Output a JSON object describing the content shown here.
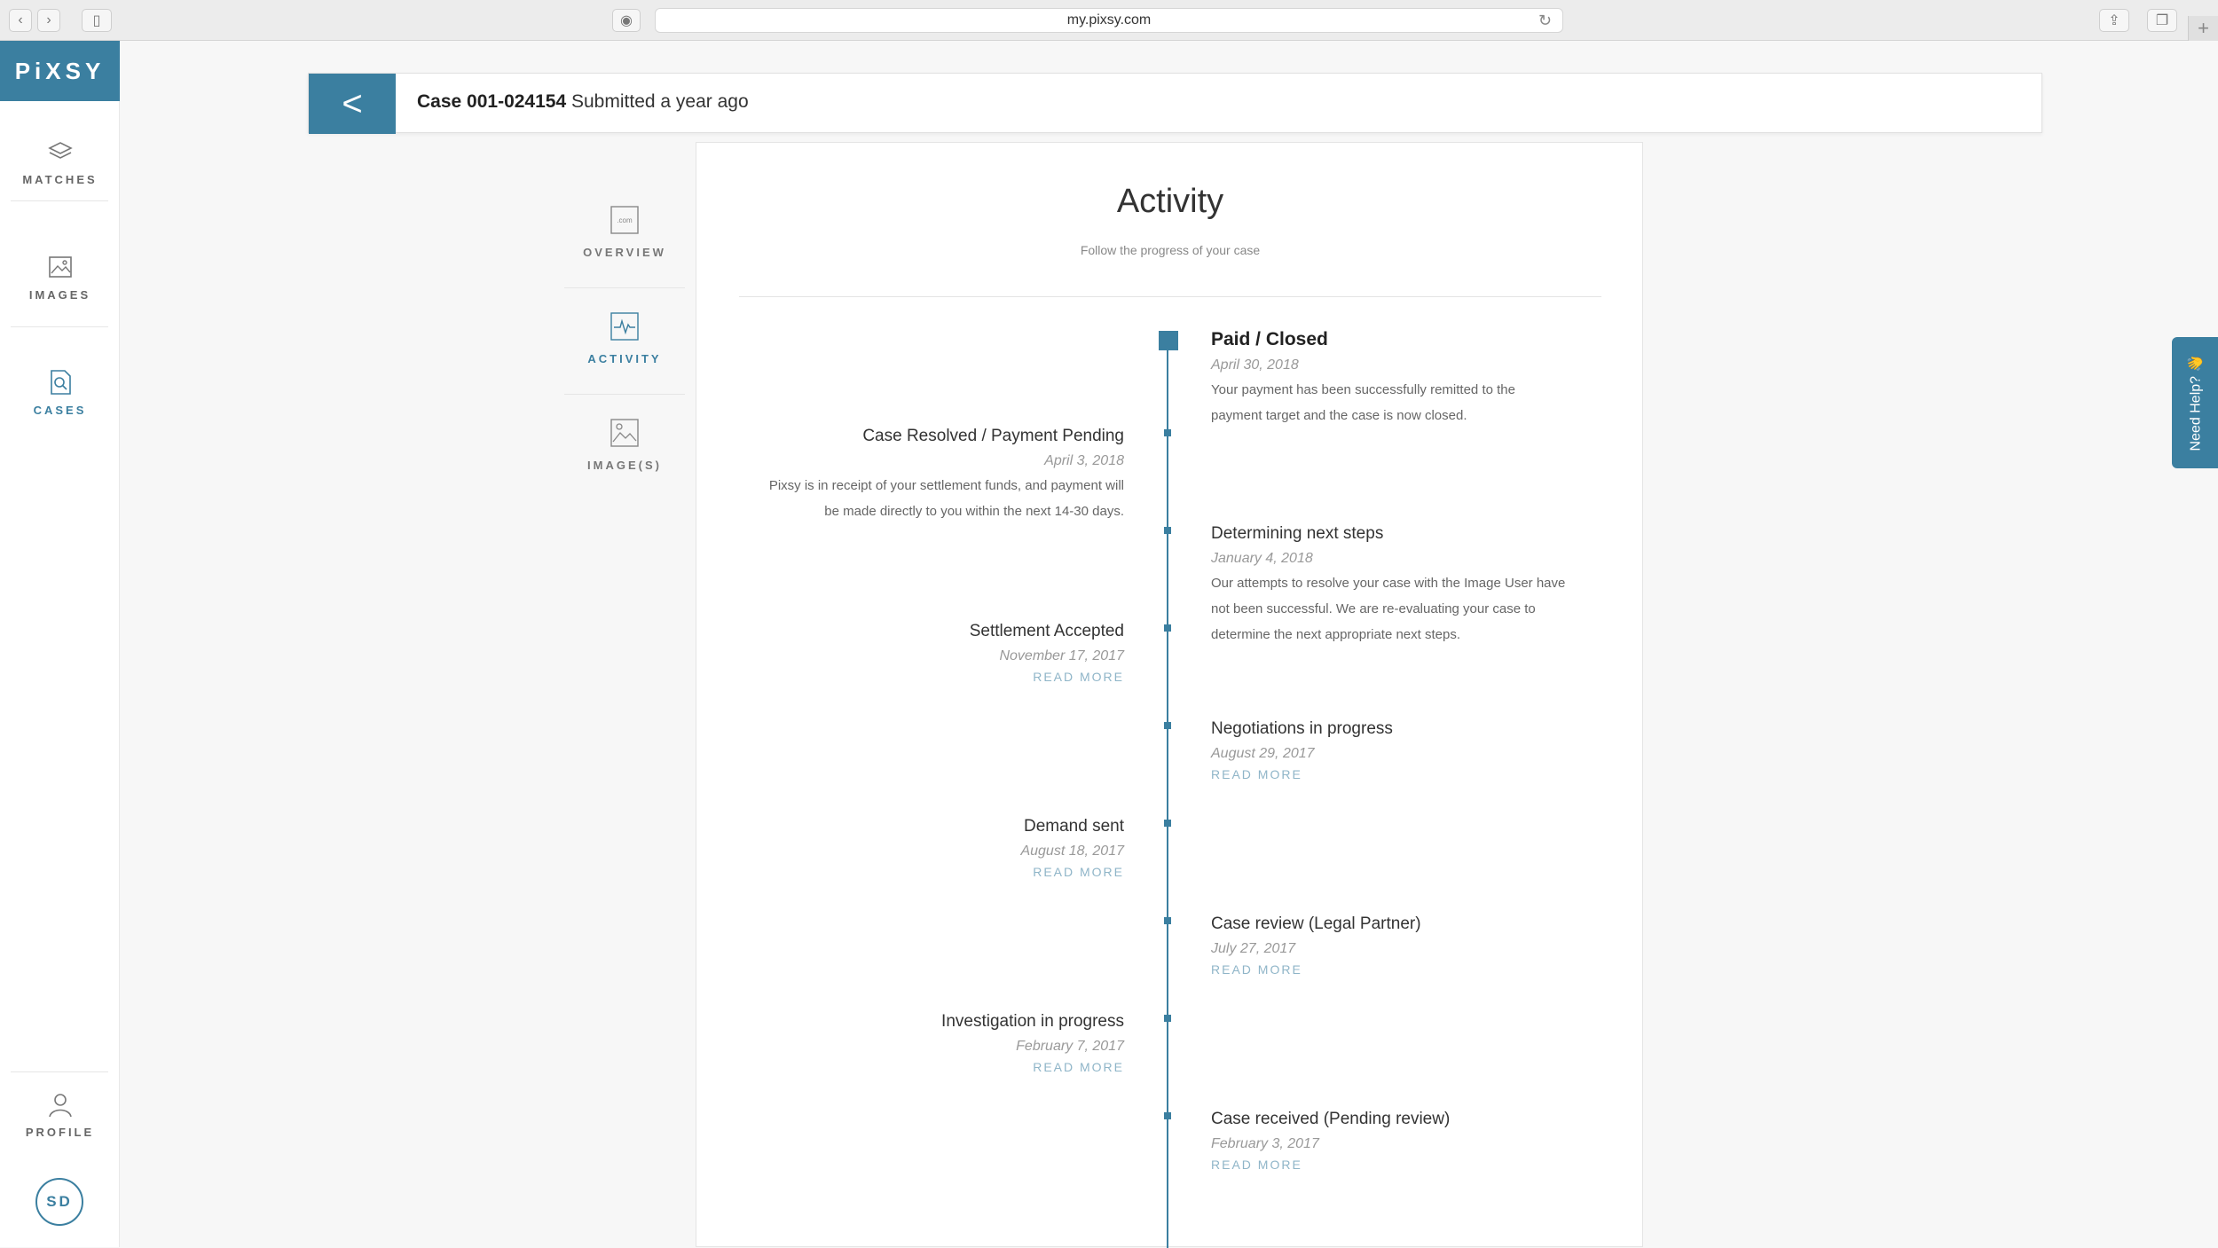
{
  "browser": {
    "url": "my.pixsy.com"
  },
  "nav": {
    "logo": "PiXSY",
    "items": [
      {
        "label": "MATCHES",
        "icon": "stack-icon"
      },
      {
        "label": "IMAGES",
        "icon": "image-icon"
      },
      {
        "label": "CASES",
        "icon": "case-search-icon"
      },
      {
        "label": "PROFILE",
        "icon": "user-icon"
      }
    ],
    "avatar": "SD"
  },
  "case": {
    "id": "Case 001-024154",
    "submitted": "Submitted a year ago"
  },
  "subnav": [
    {
      "label": "OVERVIEW",
      "icon": "website-icon"
    },
    {
      "label": "ACTIVITY",
      "icon": "pulse-icon"
    },
    {
      "label": "IMAGE(S)",
      "icon": "picture-icon"
    }
  ],
  "activity": {
    "title": "Activity",
    "subtitle": "Follow the progress of your case",
    "events": [
      {
        "title": "Paid / Closed",
        "date": "April 30, 2018",
        "text": [
          "Your payment has been successfully remitted to the",
          "payment target and the case is now closed."
        ]
      },
      {
        "title": "Case Resolved / Payment Pending",
        "date": "April 3, 2018",
        "text": [
          "Pixsy is in receipt of your settlement funds, and payment will",
          "be made directly to you within the next 14-30 days."
        ]
      },
      {
        "title": "Determining next steps",
        "date": "January 4, 2018",
        "text": [
          "Our attempts to resolve your case with the Image User have",
          "not been successful. We are re-evaluating your case to",
          "determine the next appropriate next steps."
        ]
      },
      {
        "title": "Settlement Accepted",
        "date": "November 17, 2017",
        "more": "READ MORE"
      },
      {
        "title": "Negotiations in progress",
        "date": "August 29, 2017",
        "more": "READ MORE"
      },
      {
        "title": "Demand sent",
        "date": "August 18, 2017",
        "more": "READ MORE"
      },
      {
        "title": "Case review (Legal Partner)",
        "date": "July 27, 2017",
        "more": "READ MORE"
      },
      {
        "title": "Investigation in progress",
        "date": "February 7, 2017",
        "more": "READ MORE"
      },
      {
        "title": "Case received (Pending review)",
        "date": "February 3, 2017",
        "more": "READ MORE"
      }
    ]
  },
  "help": {
    "label": "Need Help? 👋"
  },
  "colors": {
    "brand": "#3b7fa0",
    "readmore": "#8fb5c8"
  }
}
